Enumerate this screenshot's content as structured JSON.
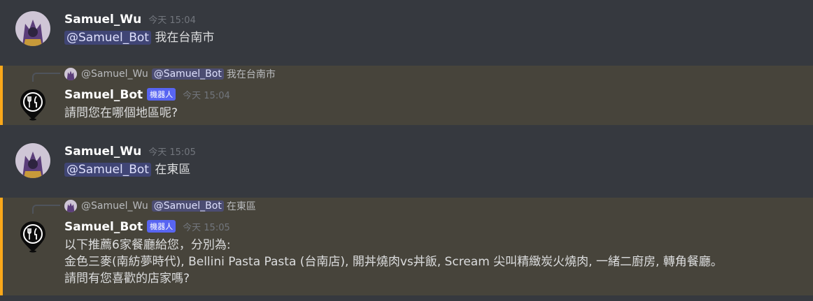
{
  "messages": [
    {
      "username": "Samuel_Wu",
      "timestamp": "今天 15:04",
      "mention": "@Samuel_Bot",
      "text": "我在台南市"
    },
    {
      "reply": {
        "username": "@Samuel_Wu",
        "mention": "@Samuel_Bot",
        "text": "我在台南市"
      },
      "username": "Samuel_Bot",
      "bot_tag": "機器人",
      "timestamp": "今天 15:04",
      "text": "請問您在哪個地區呢?"
    },
    {
      "username": "Samuel_Wu",
      "timestamp": "今天 15:05",
      "mention": "@Samuel_Bot",
      "text": "在東區"
    },
    {
      "reply": {
        "username": "@Samuel_Wu",
        "mention": "@Samuel_Bot",
        "text": "在東區"
      },
      "username": "Samuel_Bot",
      "bot_tag": "機器人",
      "timestamp": "今天 15:05",
      "lines": [
        "以下推薦6家餐廳給您，分別為:",
        "金色三麥(南紡夢時代), Bellini Pasta Pasta (台南店), 開丼燒肉vs丼飯, Scream 尖叫精緻炭火燒肉, 一緒二廚房, 轉角餐廳。",
        "請問有您喜歡的店家嗎?"
      ]
    }
  ],
  "colors": {
    "background": "#36393f",
    "highlight": "#47443b",
    "accent_bar": "#faa81a",
    "bot_tag": "#5865f2"
  }
}
